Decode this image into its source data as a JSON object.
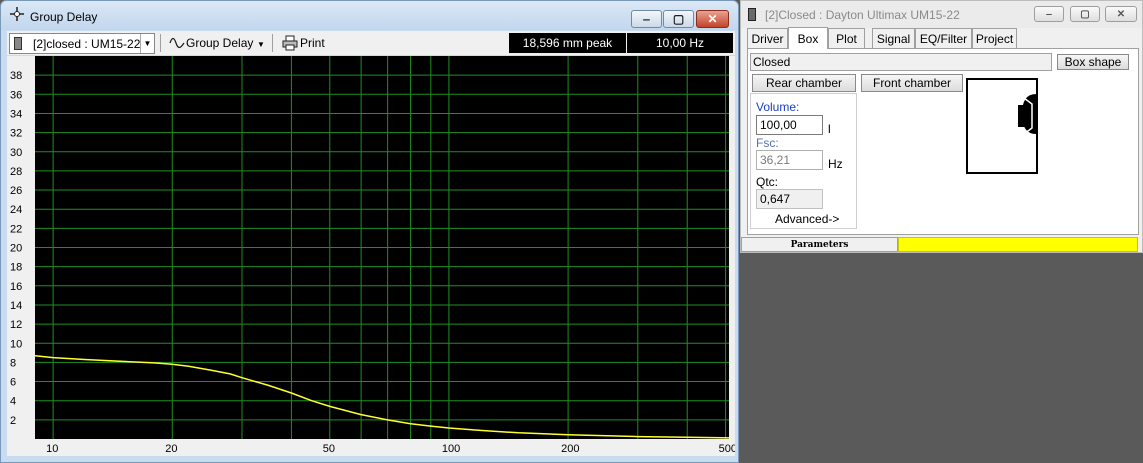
{
  "group_delay_window": {
    "title": "Group Delay",
    "toolbar": {
      "project_select": "[2]closed : UM15-22",
      "plot_select": "Group Delay",
      "print_label": "Print",
      "peak_readout": "18,596 mm peak",
      "freq_readout": "10,00 Hz"
    },
    "caption_buttons": {
      "minimize": "‒",
      "maximize": "▢",
      "close": "✕"
    }
  },
  "chart_data": {
    "type": "line",
    "title": "",
    "xlabel": "",
    "ylabel": "",
    "x_scale": "log",
    "xlim": [
      9,
      510
    ],
    "ylim": [
      0,
      40
    ],
    "grid": true,
    "background_color": "#000000",
    "grid_color": "#1f8f1f",
    "line_color": "#ffff30",
    "y_ticks": [
      2,
      4,
      6,
      8,
      10,
      12,
      14,
      16,
      18,
      20,
      22,
      24,
      26,
      28,
      30,
      32,
      34,
      36,
      38
    ],
    "x_tick_labels": [
      10,
      20,
      50,
      100,
      200,
      500
    ],
    "x_grid": [
      10,
      20,
      30,
      40,
      50,
      60,
      70,
      80,
      90,
      100,
      200,
      300,
      400,
      500
    ],
    "series": [
      {
        "x": [
          9,
          10,
          12,
          15,
          18,
          20,
          22,
          25,
          28,
          30,
          35,
          40,
          45,
          50,
          60,
          70,
          80,
          90,
          100,
          120,
          150,
          200,
          300,
          400,
          510
        ],
        "y": [
          8.7,
          8.5,
          8.3,
          8.1,
          7.95,
          7.8,
          7.6,
          7.2,
          6.8,
          6.4,
          5.6,
          4.8,
          4.0,
          3.4,
          2.55,
          2.0,
          1.6,
          1.35,
          1.15,
          0.9,
          0.65,
          0.45,
          0.25,
          0.18,
          0.12
        ]
      }
    ]
  },
  "dayton_window": {
    "title": "[2]Closed : Dayton Ultimax UM15-22",
    "caption_buttons": {
      "minimize": "‒",
      "maximize": "▢",
      "close": "✕"
    },
    "tabs": [
      "Driver",
      "Box",
      "Plot",
      "Signal",
      "EQ/Filter",
      "Project"
    ],
    "active_tab": "Box",
    "box_type": "Closed",
    "box_shape_button": "Box shape",
    "rear_chamber_button": "Rear chamber",
    "front_chamber_button": "Front chamber",
    "volume_label": "Volume:",
    "volume_value": "100,00",
    "volume_unit": "l",
    "fsc_label": "Fsc:",
    "fsc_value": "36,21",
    "fsc_unit": "Hz",
    "qtc_label": "Qtc:",
    "qtc_value": "0,647",
    "advanced_button": "Advanced->",
    "status_label": "Parameters",
    "status_color": "#ffff00"
  }
}
